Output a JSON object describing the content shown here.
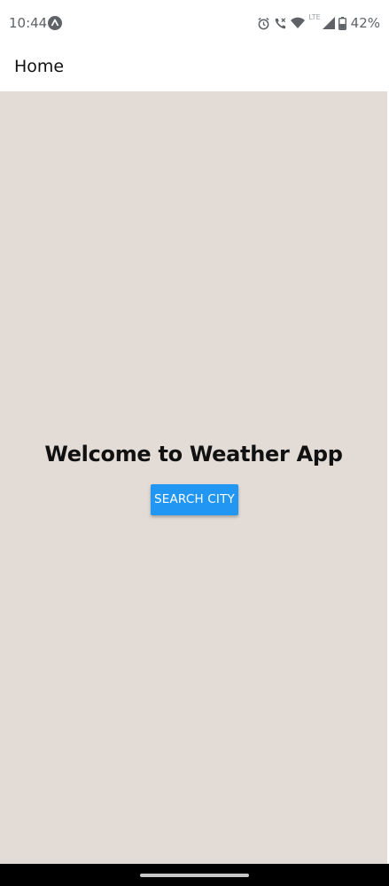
{
  "status_bar": {
    "time": "10:44",
    "notification_icon": "app-notification-icon",
    "icons": [
      "alarm-icon",
      "wifi-calling-icon",
      "wifi-icon",
      "lte-icon",
      "signal-icon",
      "battery-icon"
    ],
    "lte_label": "LTE",
    "battery": "42%"
  },
  "app_bar": {
    "title": "Home"
  },
  "main": {
    "welcome_text": "Welcome to Weather App",
    "search_button_label": "SEARCH CITY"
  },
  "colors": {
    "background": "#e2dbd6",
    "button": "#2196f3",
    "button_text": "#ffffff"
  }
}
